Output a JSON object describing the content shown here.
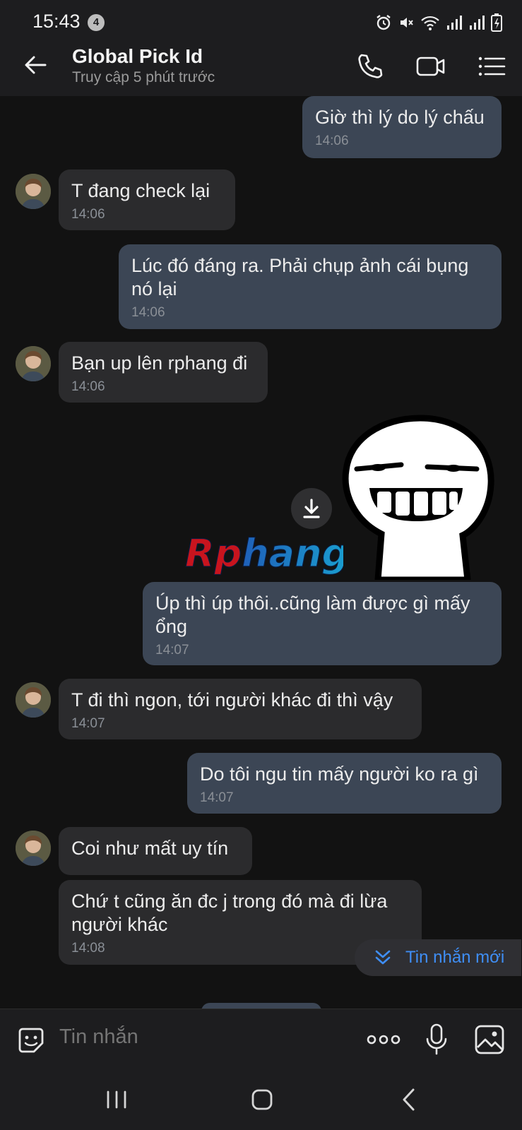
{
  "status_bar": {
    "time": "15:43",
    "notification_count": "4",
    "icons": [
      "alarm-icon",
      "mute-icon",
      "wifi-icon",
      "signal-icon",
      "signal-icon",
      "battery-charging-icon"
    ]
  },
  "header": {
    "title": "Global Pick Id",
    "subtitle": "Truy cập 5 phút trước",
    "icons": [
      "back-arrow-icon",
      "phone-icon",
      "video-call-icon",
      "menu-list-icon"
    ]
  },
  "messages": [
    {
      "direction": "out",
      "text": "Giờ thì lý do lý chấu",
      "time": "14:06"
    },
    {
      "direction": "in",
      "text": "T đang check lại",
      "time": "14:06"
    },
    {
      "direction": "out",
      "text": "Lúc đó đáng ra. Phải chụp ảnh cái bụng nó lại",
      "time": "14:06"
    },
    {
      "direction": "in",
      "text": "Bạn up lên rphang đi",
      "time": "14:06"
    },
    {
      "direction": "out",
      "type": "sticker",
      "sticker_text": "Rphang"
    },
    {
      "direction": "out",
      "text": "Úp thì úp thôi..cũng làm được gì mấy ổng",
      "time": "14:07"
    },
    {
      "direction": "in",
      "text": "T đi thì ngon, tới người khác đi thì vậy",
      "time": "14:07"
    },
    {
      "direction": "out",
      "text": "Do tôi ngu tin mấy người ko ra gì",
      "time": "14:07"
    },
    {
      "direction": "in",
      "text": "Coi như mất uy tín",
      "time": ""
    },
    {
      "direction": "in",
      "text": "Chứ t cũng ăn đc j trong đó mà đi lừa người khác",
      "time": "14:08"
    }
  ],
  "new_message_pill": {
    "label": "Tin nhắn mới"
  },
  "composer": {
    "placeholder": "Tin nhắn"
  },
  "colors": {
    "background": "#121212",
    "incoming_bubble": "#2b2b2d",
    "outgoing_bubble": "#3c4655",
    "accent": "#3f8ef5"
  }
}
